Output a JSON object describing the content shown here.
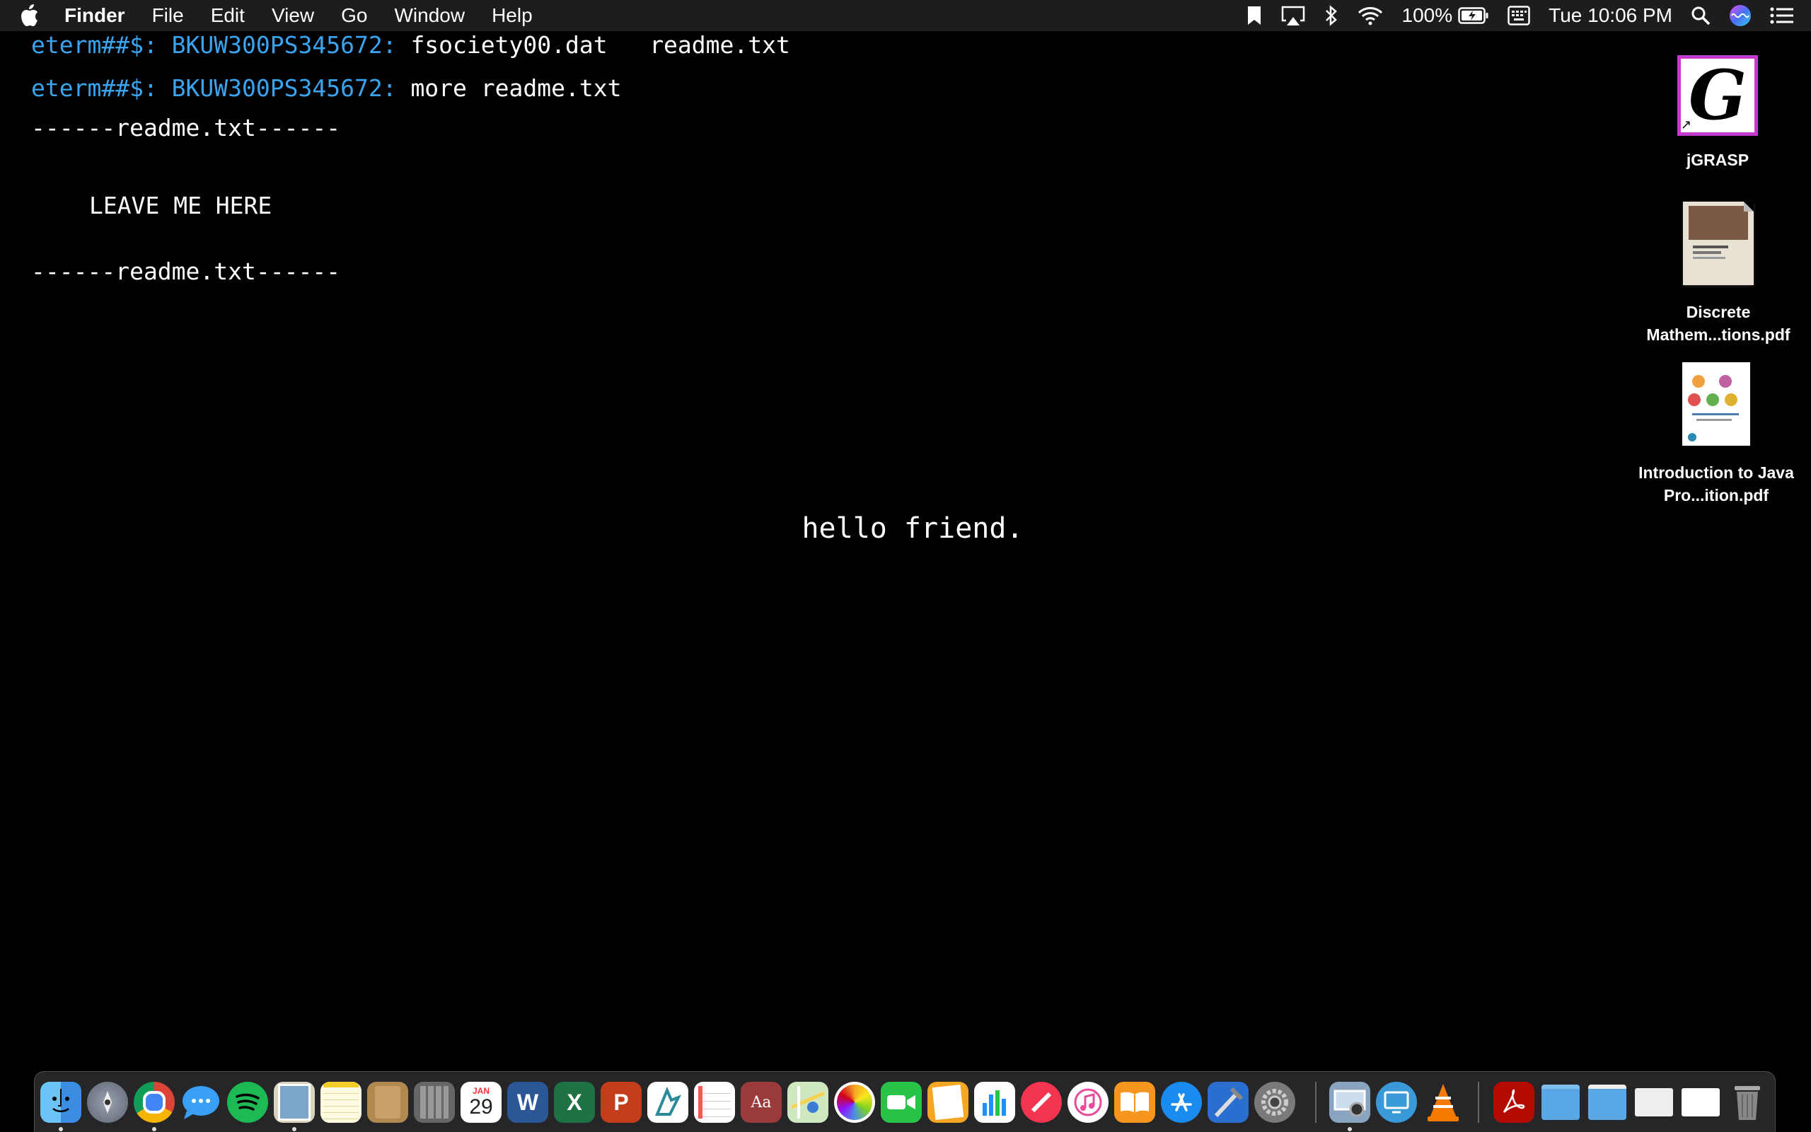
{
  "menubar": {
    "apple_icon": "apple-icon",
    "app_name": "Finder",
    "menus": [
      "File",
      "Edit",
      "View",
      "Go",
      "Window",
      "Help"
    ],
    "battery_percent": "100%",
    "datetime": "Tue 10:06 PM",
    "status_icons": [
      "bookmark-icon",
      "airplay-icon",
      "bluetooth-icon",
      "wifi-icon",
      "battery-charging-icon",
      "input-source-icon",
      "spotlight-icon",
      "siri-icon",
      "notification-center-icon"
    ]
  },
  "terminal": {
    "line1": {
      "prompt": "eterm##$: BKUW300PS345672:",
      "command": "fsociety00.dat   readme.txt"
    },
    "line2": {
      "prompt": "eterm##$: BKUW300PS345672:",
      "command": "more readme.txt"
    },
    "header": "------readme.txt------",
    "message": "LEAVE ME HERE",
    "footer": "------readme.txt------",
    "center_text": "hello friend."
  },
  "desktop_icons": [
    {
      "label": "jGRASP",
      "icon": "jgrasp-icon"
    },
    {
      "label": "Discrete Mathem...tions.pdf",
      "icon": "pdf-document-icon"
    },
    {
      "label": "Introduction to Java Pro...ition.pdf",
      "icon": "pdf-document-icon"
    }
  ],
  "dock": {
    "items": [
      "Finder",
      "Launchpad",
      "Google Chrome",
      "Messages",
      "Spotify",
      "Preview",
      "Notes",
      "Contacts",
      "Calculator",
      "Calendar",
      "Microsoft Word",
      "Microsoft Excel",
      "Microsoft PowerPoint",
      "jGRASP",
      "Reminders",
      "Dictionary",
      "Maps",
      "Photos",
      "FaceTime",
      "Pages",
      "Numbers",
      "News",
      "iTunes",
      "iBooks",
      "App Store",
      "Xcode",
      "System Preferences",
      "Image Capture",
      "Screen Sharing",
      "VLC",
      "Adobe Acrobat Reader",
      "Applications",
      "Documents",
      "Downloads",
      "Recent File",
      "Trash"
    ],
    "calendar_month": "JAN",
    "calendar_day": "29"
  },
  "colors": {
    "prompt": "#3ba4f0",
    "background": "#000000",
    "menubar": "#1d1d1f",
    "selection_border": "#c13ccf"
  }
}
